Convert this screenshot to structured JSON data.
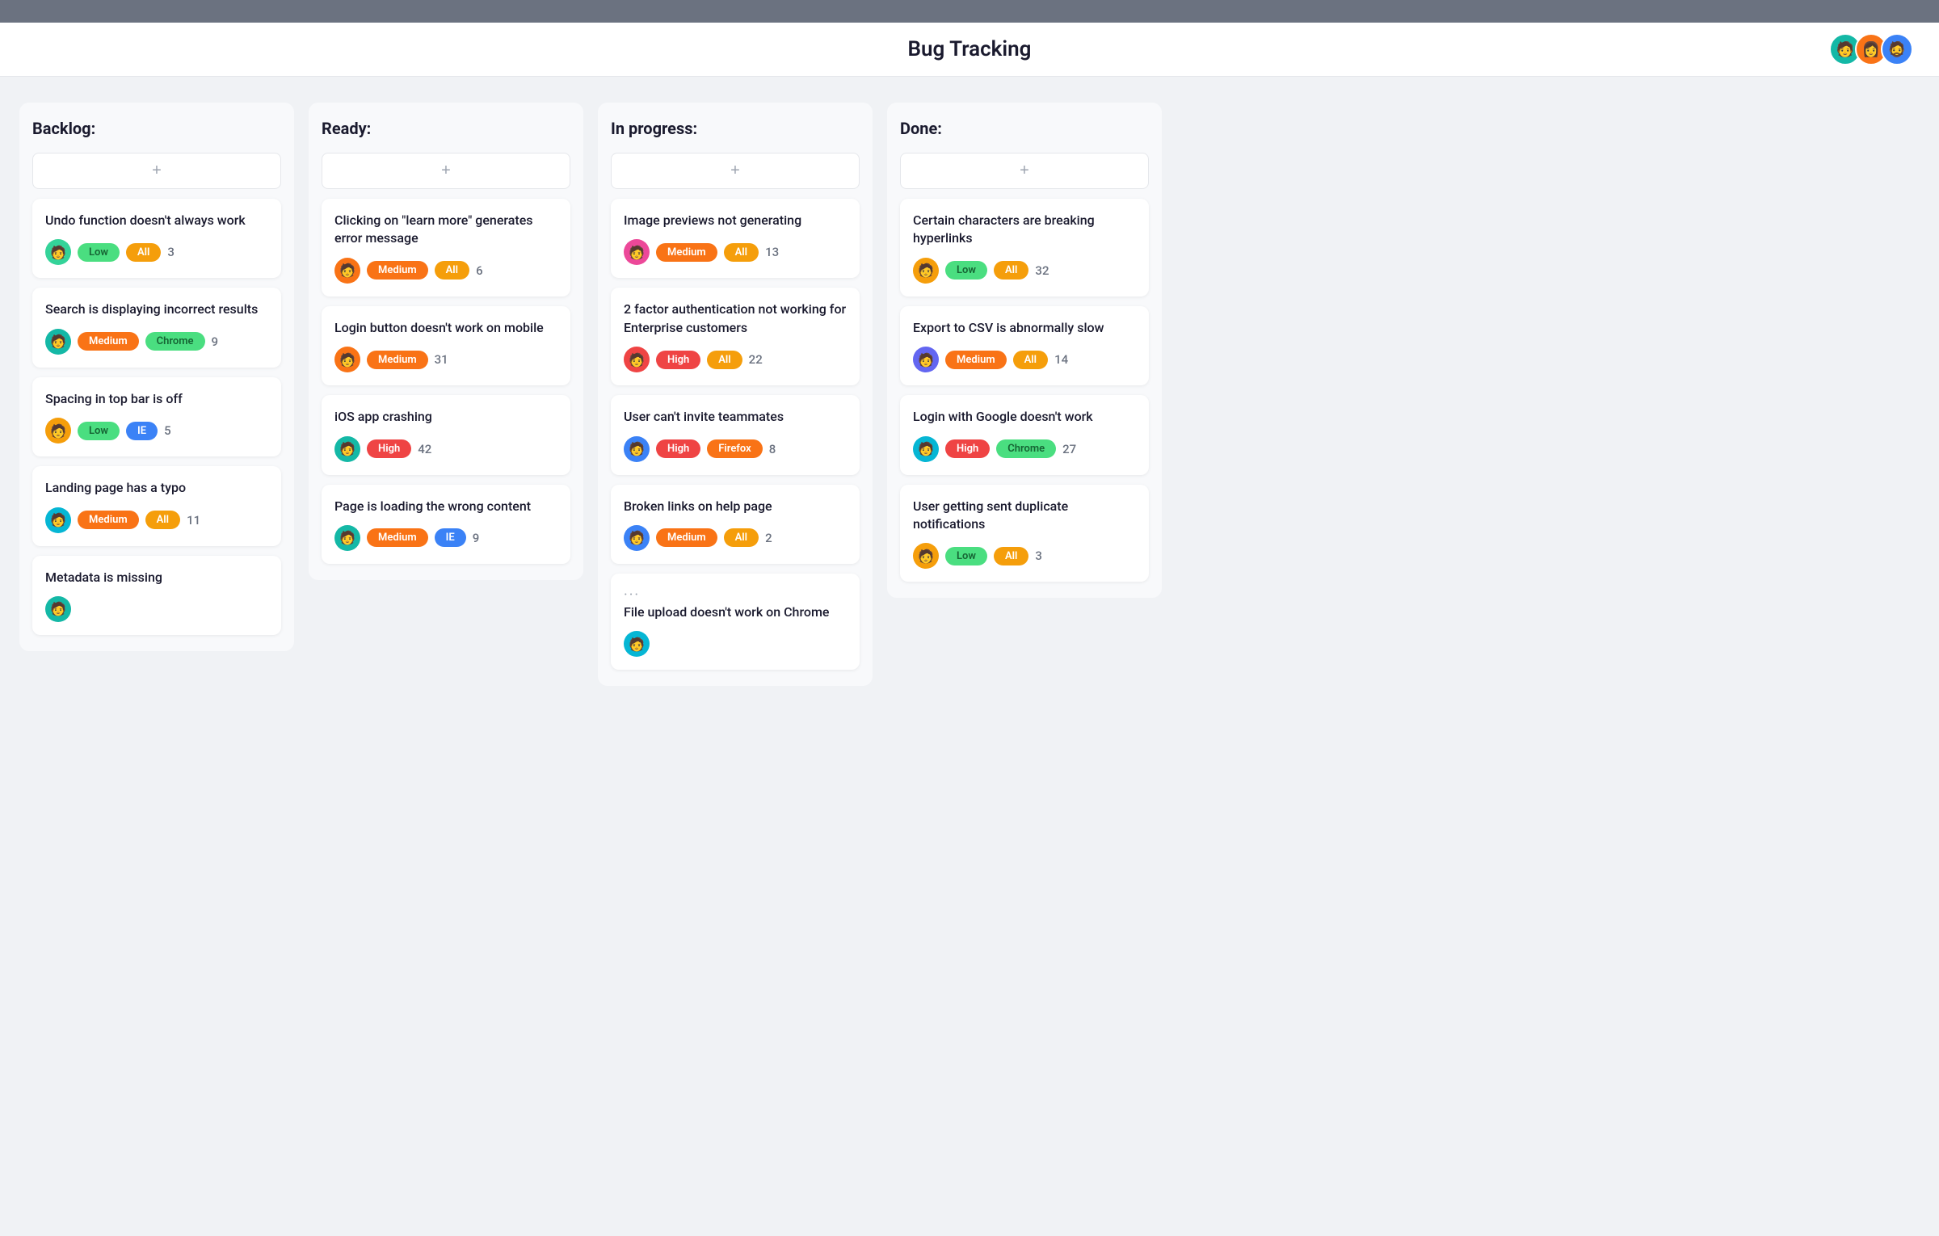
{
  "app": {
    "title": "Bug Tracking",
    "topbar_height": 28
  },
  "header": {
    "title": "Bug Tracking",
    "avatars": [
      {
        "color": "av-teal",
        "emoji": "🧑"
      },
      {
        "color": "av-orange",
        "emoji": "👩"
      },
      {
        "color": "av-blue",
        "emoji": "🧔"
      }
    ]
  },
  "add_label": "+",
  "columns": [
    {
      "id": "backlog",
      "label": "Backlog:",
      "cards": [
        {
          "title": "Undo function doesn't always work",
          "avatar_color": "av-green",
          "priority": "Low",
          "priority_class": "badge-low",
          "tag": "All",
          "tag_class": "badge-all",
          "count": "3"
        },
        {
          "title": "Search is displaying incorrect results",
          "avatar_color": "av-teal",
          "priority": "Medium",
          "priority_class": "badge-medium",
          "tag": "Chrome",
          "tag_class": "badge-chrome",
          "count": "9"
        },
        {
          "title": "Spacing in top bar is off",
          "avatar_color": "av-yellow",
          "priority": "Low",
          "priority_class": "badge-low",
          "tag": "IE",
          "tag_class": "badge-ie",
          "count": "5"
        },
        {
          "title": "Landing page has a typo",
          "avatar_color": "av-cyan",
          "priority": "Medium",
          "priority_class": "badge-medium",
          "tag": "All",
          "tag_class": "badge-all",
          "count": "11"
        },
        {
          "title": "Metadata is missing",
          "avatar_color": "av-teal",
          "priority": null,
          "tag": null,
          "count": null
        }
      ]
    },
    {
      "id": "ready",
      "label": "Ready:",
      "cards": [
        {
          "title": "Clicking on \"learn more\" generates error message",
          "avatar_color": "av-orange",
          "priority": "Medium",
          "priority_class": "badge-medium",
          "tag": "All",
          "tag_class": "badge-all",
          "count": "6"
        },
        {
          "title": "Login button doesn't work on mobile",
          "avatar_color": "av-orange",
          "priority": "Medium",
          "priority_class": "badge-medium",
          "tag": null,
          "tag_class": null,
          "count": "31"
        },
        {
          "title": "iOS app crashing",
          "avatar_color": "av-teal",
          "priority": "High",
          "priority_class": "badge-high",
          "tag": null,
          "tag_class": null,
          "count": "42"
        },
        {
          "title": "Page is loading the wrong content",
          "avatar_color": "av-teal",
          "priority": "Medium",
          "priority_class": "badge-medium",
          "tag": "IE",
          "tag_class": "badge-ie",
          "count": "9"
        }
      ]
    },
    {
      "id": "in-progress",
      "label": "In progress:",
      "cards": [
        {
          "title": "Image previews not generating",
          "avatar_color": "av-pink",
          "priority": "Medium",
          "priority_class": "badge-medium",
          "tag": "All",
          "tag_class": "badge-all",
          "count": "13"
        },
        {
          "title": "2 factor authentication not working for Enterprise customers",
          "avatar_color": "av-red",
          "priority": "High",
          "priority_class": "badge-high",
          "tag": "All",
          "tag_class": "badge-all",
          "count": "22"
        },
        {
          "title": "User can't invite teammates",
          "avatar_color": "av-blue",
          "priority": "High",
          "priority_class": "badge-high",
          "tag": "Firefox",
          "tag_class": "badge-firefox",
          "count": "8"
        },
        {
          "title": "Broken links on help page",
          "avatar_color": "av-blue",
          "priority": "Medium",
          "priority_class": "badge-medium",
          "tag": "All",
          "tag_class": "badge-all",
          "count": "2"
        },
        {
          "title": "File upload doesn't work on Chrome",
          "avatar_color": "av-cyan",
          "priority": null,
          "tag": null,
          "count": null,
          "has_dots": true
        }
      ]
    },
    {
      "id": "done",
      "label": "Done:",
      "cards": [
        {
          "title": "Certain characters are breaking hyperlinks",
          "avatar_color": "av-yellow",
          "priority": "Low",
          "priority_class": "badge-low",
          "tag": "All",
          "tag_class": "badge-all",
          "count": "32"
        },
        {
          "title": "Export to CSV is abnormally slow",
          "avatar_color": "av-indigo",
          "priority": "Medium",
          "priority_class": "badge-medium",
          "tag": "All",
          "tag_class": "badge-all",
          "count": "14"
        },
        {
          "title": "Login with Google doesn't work",
          "avatar_color": "av-cyan",
          "priority": "High",
          "priority_class": "badge-high",
          "tag": "Chrome",
          "tag_class": "badge-chrome",
          "count": "27"
        },
        {
          "title": "User getting sent duplicate notifications",
          "avatar_color": "av-yellow",
          "priority": "Low",
          "priority_class": "badge-low",
          "tag": "All",
          "tag_class": "badge-all",
          "count": "3"
        }
      ]
    }
  ]
}
